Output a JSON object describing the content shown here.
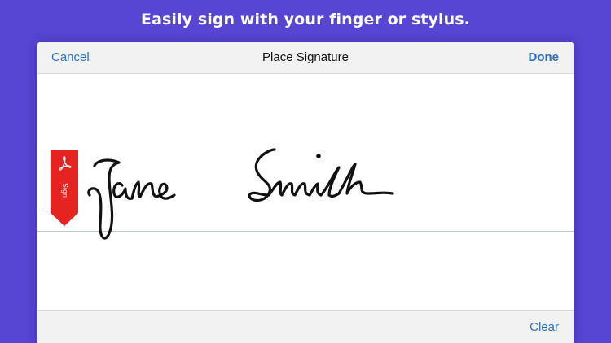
{
  "headline": "Easily sign with your finger or stylus.",
  "nav": {
    "cancel_label": "Cancel",
    "title": "Place Signature",
    "done_label": "Done"
  },
  "sign_tag": {
    "label": "Sign",
    "icon": "acrobat-logo-icon",
    "color": "#e52320"
  },
  "signature": {
    "text": "Jane Smith"
  },
  "footer": {
    "clear_label": "Clear"
  },
  "colors": {
    "background": "#5646d3",
    "accent": "#2a71c2"
  }
}
